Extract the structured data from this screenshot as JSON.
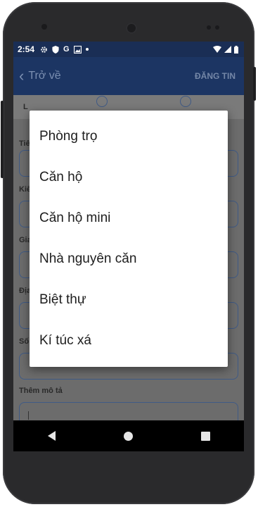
{
  "status_bar": {
    "time": "2:54",
    "left_icons": [
      "gear-icon",
      "shield-icon",
      "google-icon",
      "photo-icon",
      "dot-icon"
    ],
    "google_letter": "G",
    "right_icons": [
      "wifi-icon",
      "signal-icon",
      "battery-icon"
    ]
  },
  "app_bar": {
    "back_label": "Trở về",
    "post_label": "ĐĂNG TIN"
  },
  "form": {
    "visible_label_fragments": [
      "L",
      "Tiê",
      "Kiể",
      "Gia",
      "Địa",
      "Số"
    ],
    "add_description_label": "Thêm mô tả"
  },
  "dialog": {
    "options": [
      "Phòng trọ",
      "Căn hộ",
      "Căn hộ mini",
      "Nhà nguyên căn",
      "Biệt thự",
      "Kí túc xá"
    ]
  },
  "colors": {
    "status_bar": "#1a2e55",
    "app_bar": "#1c3563",
    "scrim_background": "#6c6c6c",
    "dialog": "#ffffff",
    "nav_bar": "#000000"
  }
}
